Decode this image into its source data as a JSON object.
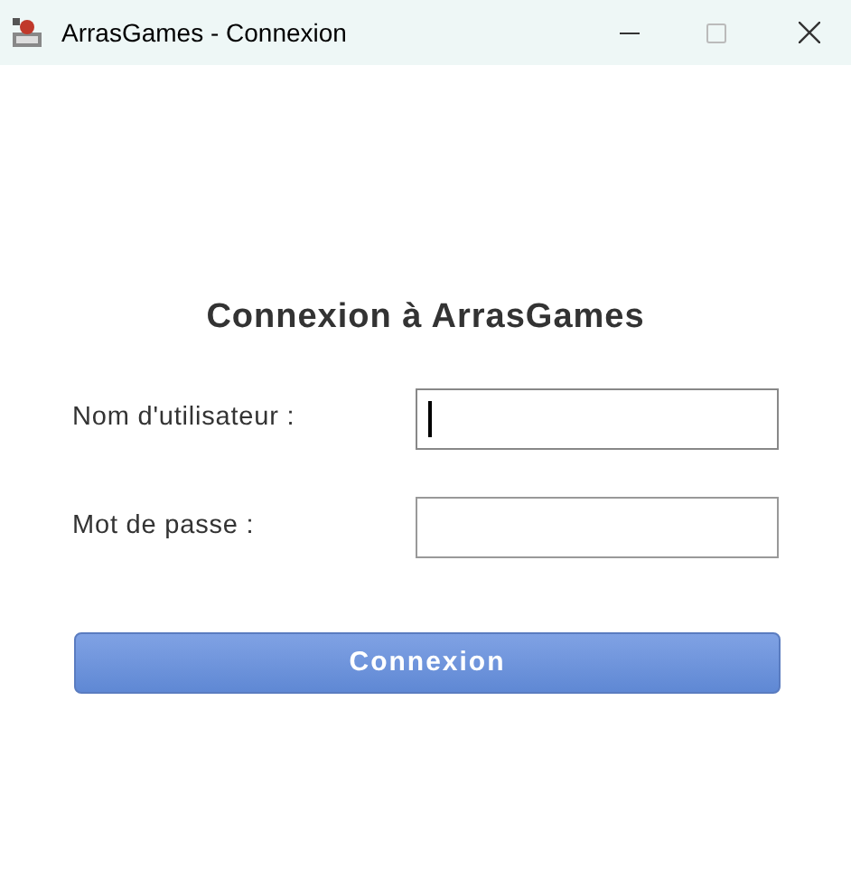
{
  "window": {
    "title": "ArrasGames - Connexion"
  },
  "heading": "Connexion à ArrasGames",
  "fields": [
    {
      "label": "Nom d'utilisateur :",
      "focused": true
    },
    {
      "label": "Mot de passe :",
      "focused": false
    }
  ],
  "button": "Connexion"
}
